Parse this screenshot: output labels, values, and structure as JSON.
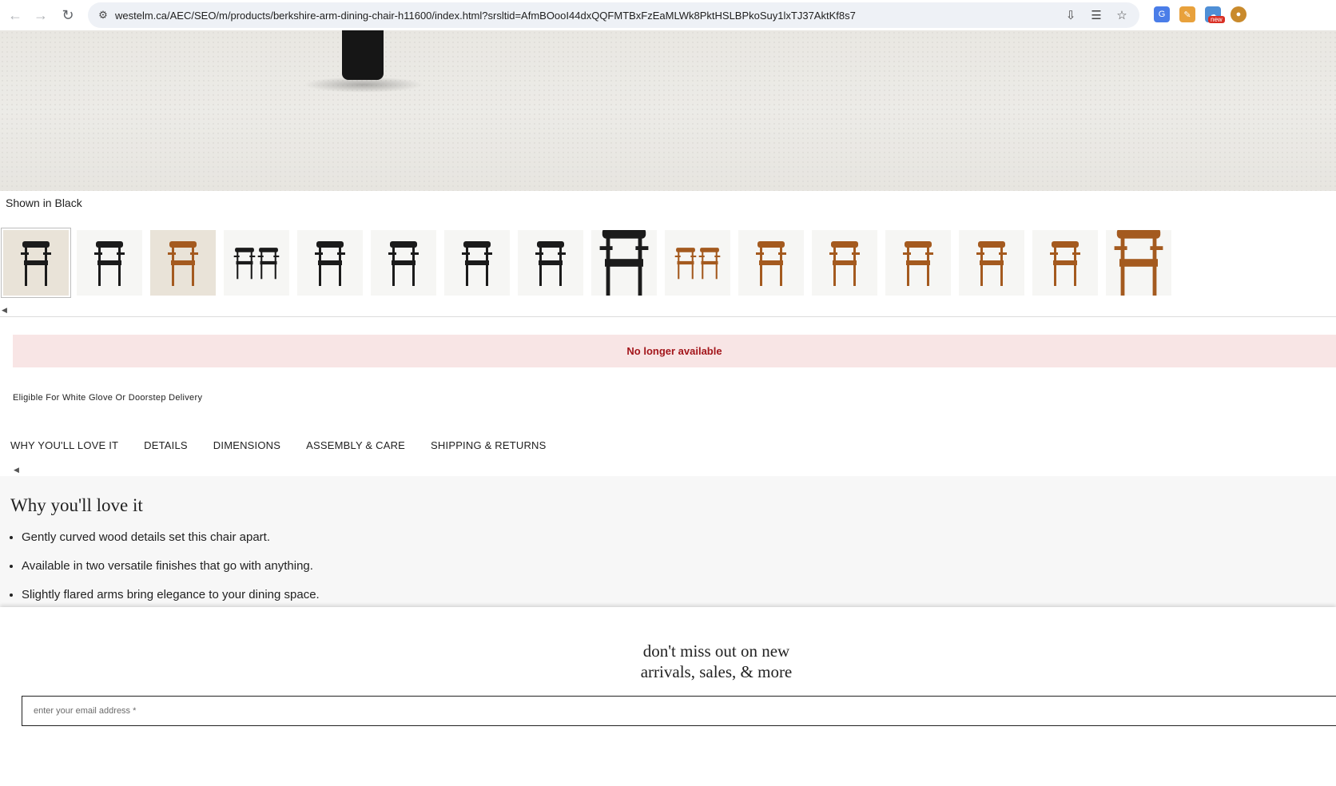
{
  "browser": {
    "url": "westelm.ca/AEC/SEO/m/products/berkshire-arm-dining-chair-h11600/index.html?srsltid=AfmBOooI44dxQQFMTBxFzEaMLWk8PktHSLBPkoSuy1lxTJ37AktKf8s7",
    "extension_badge": "new"
  },
  "product": {
    "shown_in": "Shown in Black",
    "status": "No longer available",
    "delivery_note": "Eligible For White Glove Or Doorstep Delivery",
    "thumbnails": [
      {
        "finish": "black",
        "kind": "scene"
      },
      {
        "finish": "black",
        "kind": "detail"
      },
      {
        "finish": "wood",
        "kind": "scene"
      },
      {
        "finish": "black",
        "kind": "pair"
      },
      {
        "finish": "black",
        "kind": "front"
      },
      {
        "finish": "black",
        "kind": "front"
      },
      {
        "finish": "black",
        "kind": "side"
      },
      {
        "finish": "black",
        "kind": "angle"
      },
      {
        "finish": "black",
        "kind": "closeup"
      },
      {
        "finish": "wood",
        "kind": "pair"
      },
      {
        "finish": "wood",
        "kind": "front"
      },
      {
        "finish": "wood",
        "kind": "front"
      },
      {
        "finish": "wood",
        "kind": "front"
      },
      {
        "finish": "wood",
        "kind": "side"
      },
      {
        "finish": "wood",
        "kind": "angle"
      },
      {
        "finish": "wood",
        "kind": "closeup"
      }
    ]
  },
  "tabs": [
    "WHY YOU'LL LOVE IT",
    "DETAILS",
    "DIMENSIONS",
    "ASSEMBLY & CARE",
    "SHIPPING & RETURNS"
  ],
  "why": {
    "heading": "Why you'll love it",
    "bullets": [
      "Gently curved wood details set this chair apart.",
      "Available in two versatile finishes that go with anything.",
      "Slightly flared arms bring elegance to your dining space."
    ]
  },
  "signup": {
    "line1": "don't miss out on new",
    "line2": "arrivals, sales, & more",
    "placeholder": "enter your email address *"
  },
  "colors": {
    "alert_bg": "#f8e5e5",
    "alert_text": "#a3161b",
    "wood": "#a45a1f",
    "black": "#1b1b1b"
  }
}
